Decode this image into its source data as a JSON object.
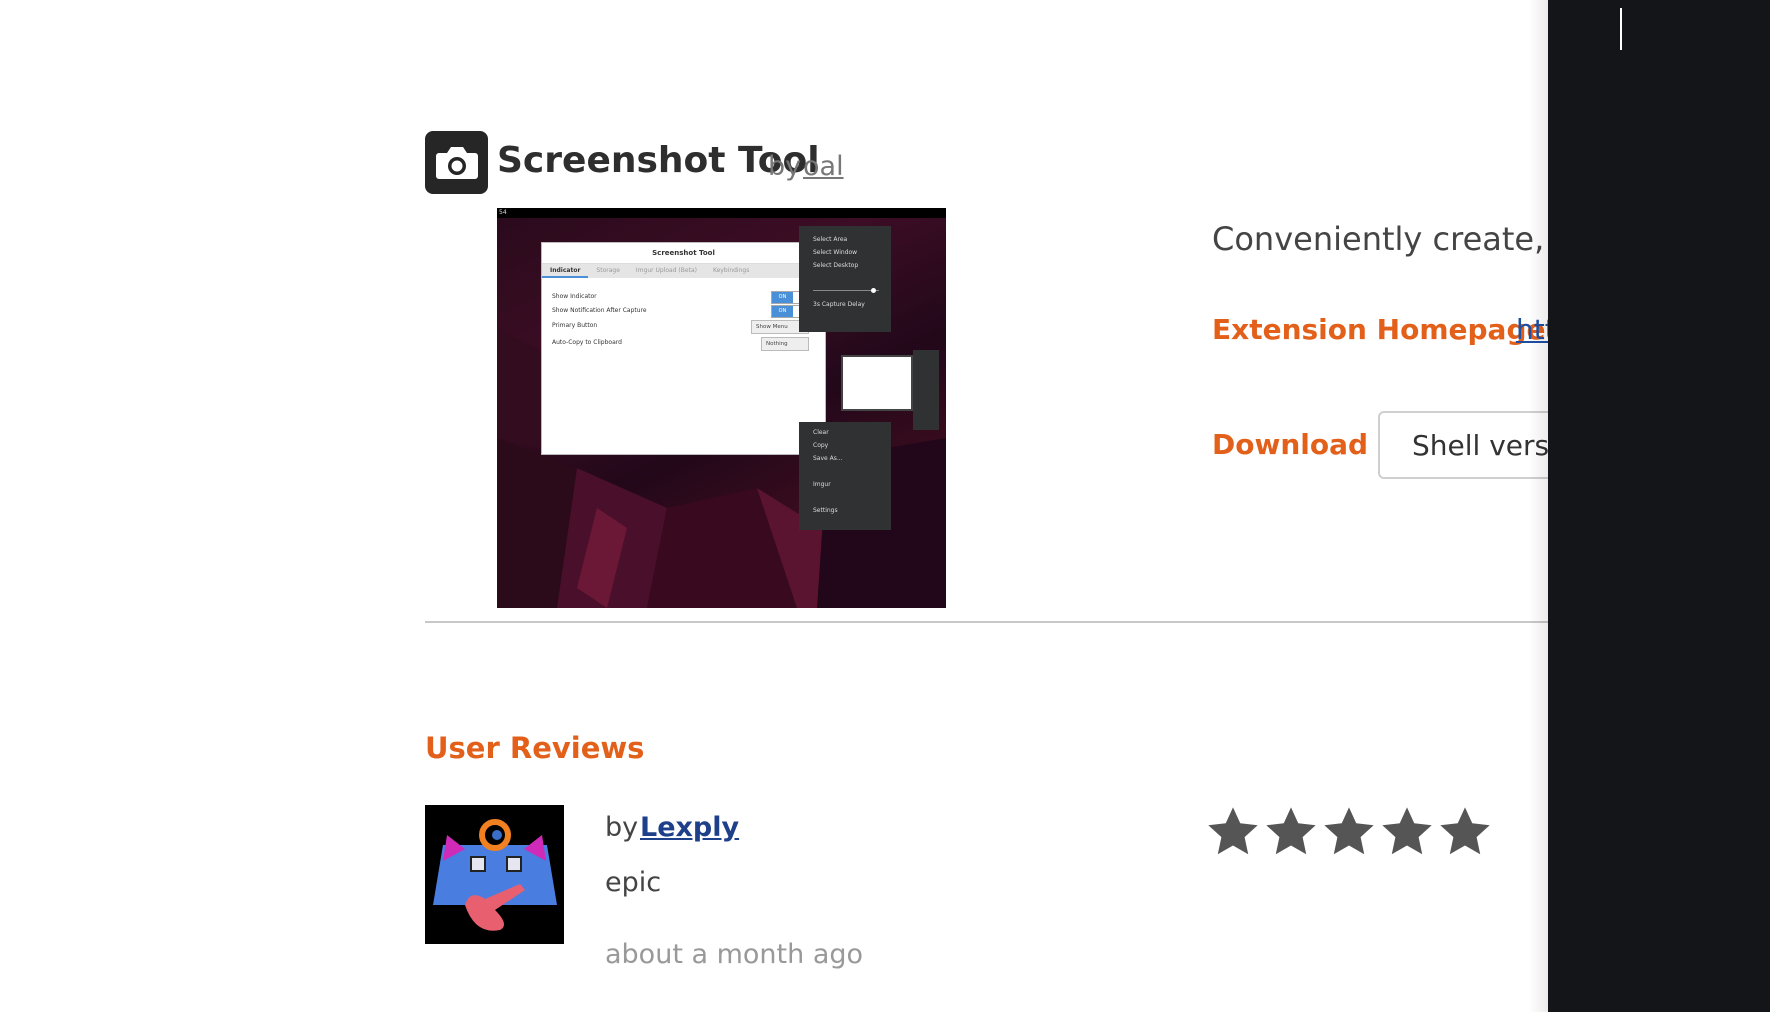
{
  "extension": {
    "title": "Screenshot Tool",
    "by": "by",
    "author": "oal",
    "description": "Conveniently create, co",
    "homepage_label": "Extension Homepage",
    "homepage_link": "htt",
    "download_label": "Download",
    "shell_version_label": "Shell versio"
  },
  "screenshot_preview": {
    "window_title": "Screenshot Tool",
    "tabs": [
      "Indicator",
      "Storage",
      "Imgur Upload (Beta)",
      "Keybindings"
    ],
    "settings": [
      {
        "label": "Show Indicator",
        "value": "ON"
      },
      {
        "label": "Show Notification After Capture",
        "value": "ON"
      },
      {
        "label": "Primary Button",
        "value": "Show Menu"
      },
      {
        "label": "Auto-Copy to Clipboard",
        "value": "Nothing"
      }
    ],
    "menu1": [
      "Select Area",
      "Select Window",
      "Select Desktop",
      "3s Capture Delay"
    ],
    "menu2": [
      "Clear",
      "Copy",
      "Save As...",
      "Imgur",
      "Settings"
    ],
    "clock": "54"
  },
  "reviews": {
    "title": "User Reviews",
    "items": [
      {
        "by": "by",
        "user": "Lexply",
        "text": "epic",
        "time": "about a month ago",
        "rating": 5
      }
    ]
  },
  "colors": {
    "accent": "#e3601a",
    "link": "#1e4fa3",
    "star": "#555555",
    "dark_panel": "#131519"
  },
  "icons": {
    "extension_icon": "camera-icon",
    "star_icon": "star-icon"
  }
}
